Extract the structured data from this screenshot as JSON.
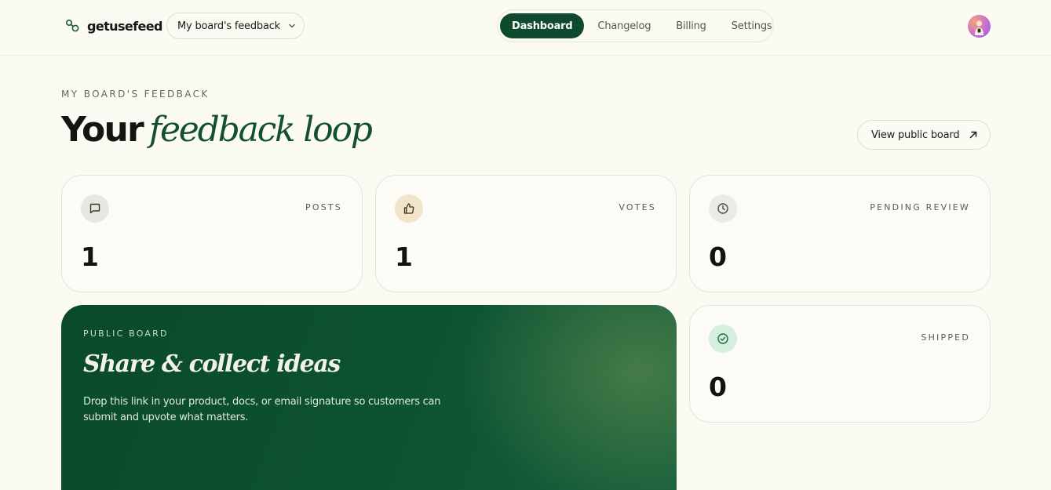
{
  "header": {
    "brand": "getusefeed",
    "board_select": "My board's feedback",
    "nav": {
      "dashboard": "Dashboard",
      "changelog": "Changelog",
      "billing": "Billing",
      "settings": "Settings",
      "active": "Dashboard"
    },
    "avatar_icon": "user-avatar"
  },
  "hero": {
    "eyebrow": "MY BOARD'S FEEDBACK",
    "title_plain": "Your",
    "title_accent": "feedback loop",
    "view_public_label": "View public board"
  },
  "stats": {
    "posts": {
      "label": "POSTS",
      "value": "1",
      "icon": "message-square-icon",
      "icon_bg": "#e7e7df"
    },
    "votes": {
      "label": "VOTES",
      "value": "1",
      "icon": "thumbs-up-icon",
      "icon_bg": "#f2e4cb"
    },
    "pending": {
      "label": "PENDING REVIEW",
      "value": "0",
      "icon": "clock-icon",
      "icon_bg": "#ebebe5"
    },
    "shipped": {
      "label": "SHIPPED",
      "value": "0",
      "icon": "check-circle-icon",
      "icon_bg": "#d6eedd"
    }
  },
  "share": {
    "eyebrow": "PUBLIC BOARD",
    "title": "Share & collect ideas",
    "description": "Drop this link in your product, docs, or email signature so customers can submit and upvote what matters."
  },
  "colors": {
    "brand_green": "#0f4a2e",
    "background": "#fbfaf3"
  }
}
